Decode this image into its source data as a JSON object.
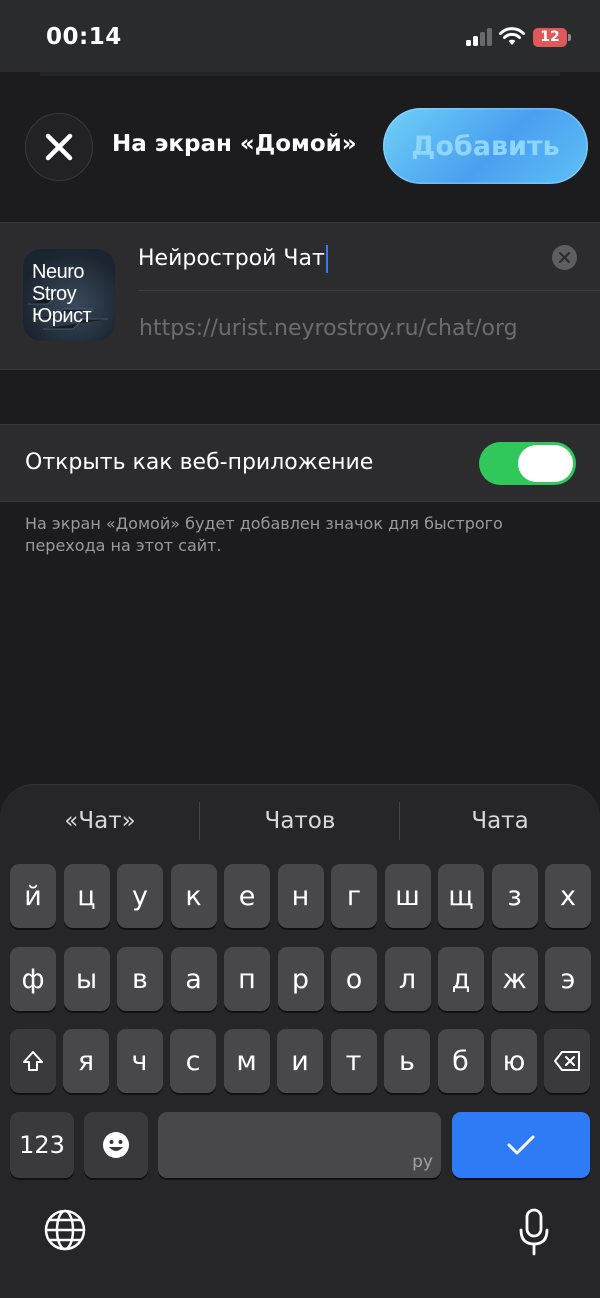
{
  "status_bar": {
    "time": "00:14",
    "battery": "12"
  },
  "header": {
    "title": "На экран «Домой»",
    "add_label": "Добавить"
  },
  "app": {
    "icon_lines": [
      "Neuro",
      "Stroy",
      "Юрист"
    ],
    "name_value": "Нейрострой Чат",
    "url": "https://urist.neyrostroy.ru/chat/org"
  },
  "web_app": {
    "label": "Открыть как веб-приложение",
    "enabled": true
  },
  "footnote": "На экран «Домой» будет добавлен значок для быстрого перехода на этот сайт.",
  "keyboard": {
    "suggestions": [
      "«Чат»",
      "Чатов",
      "Чата"
    ],
    "row1": [
      "й",
      "ц",
      "у",
      "к",
      "е",
      "н",
      "г",
      "ш",
      "щ",
      "з",
      "х"
    ],
    "row2": [
      "ф",
      "ы",
      "в",
      "а",
      "п",
      "р",
      "о",
      "л",
      "д",
      "ж",
      "э"
    ],
    "row3": [
      "я",
      "ч",
      "с",
      "м",
      "и",
      "т",
      "ь",
      "б",
      "ю"
    ],
    "numbers_label": "123",
    "space_lang": "ру"
  },
  "colors": {
    "accent": "#2f7bf6",
    "toggle_on": "#30c75b",
    "add_gradient": "#5fc0f5"
  }
}
